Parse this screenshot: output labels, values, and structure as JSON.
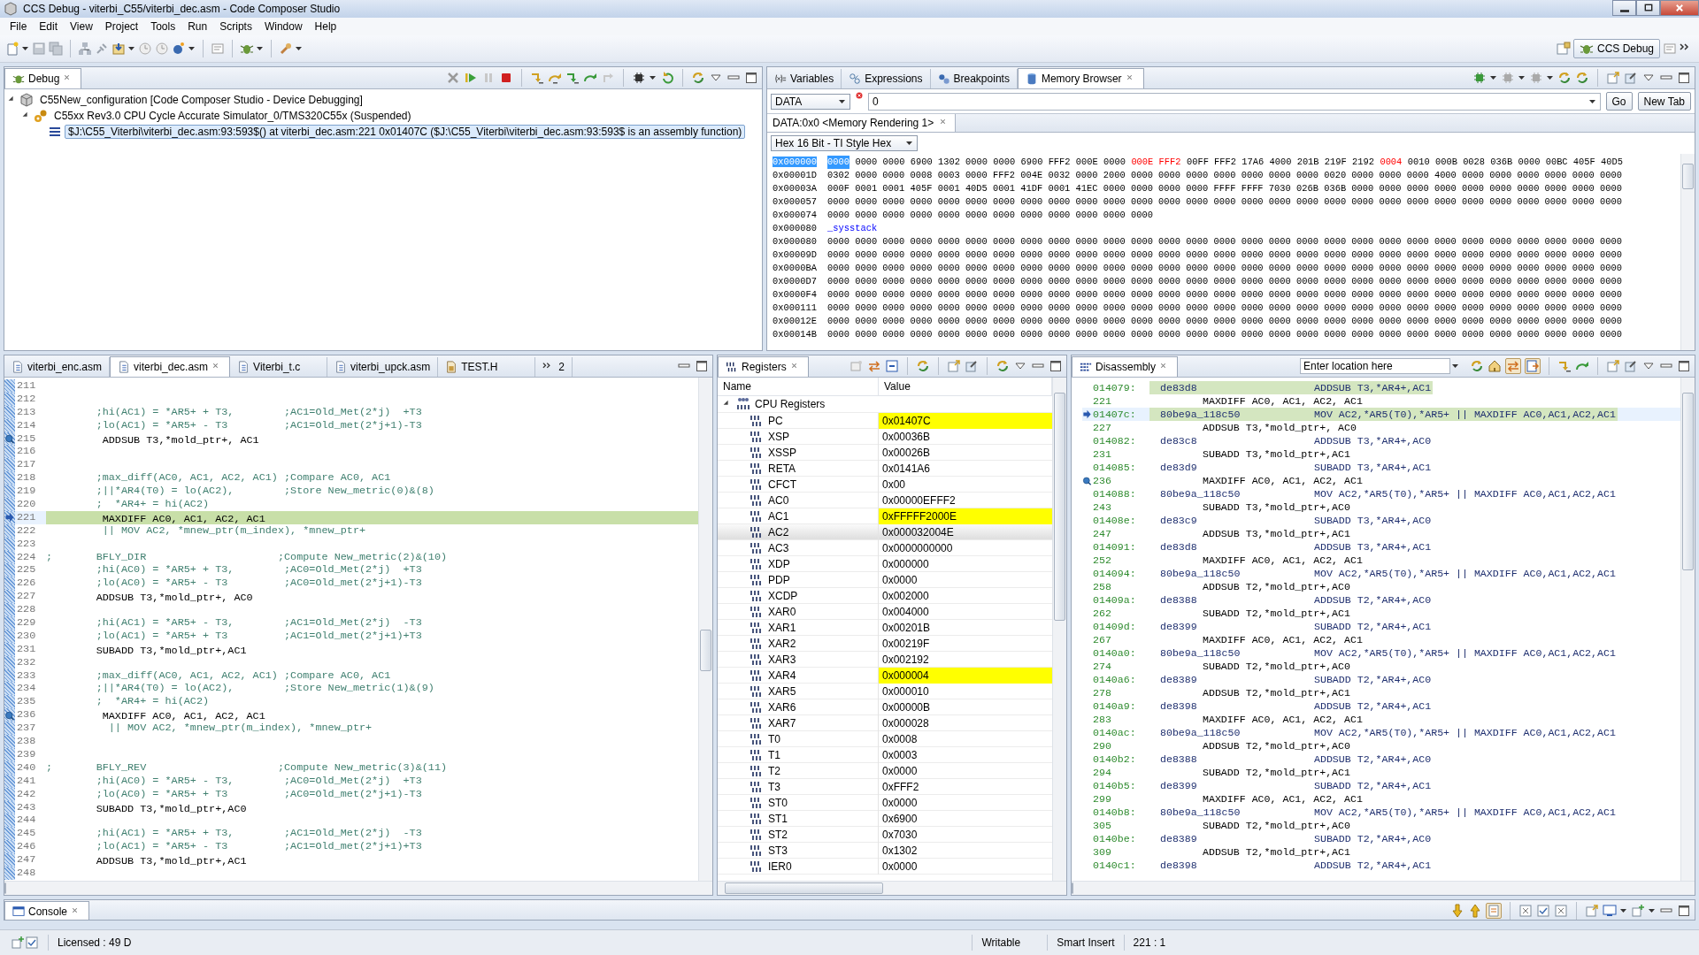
{
  "window": {
    "title": "CCS Debug - viterbi_C55/viterbi_dec.asm - Code Composer Studio"
  },
  "menu": [
    "File",
    "Edit",
    "View",
    "Project",
    "Tools",
    "Run",
    "Scripts",
    "Window",
    "Help"
  ],
  "perspective": {
    "label": "CCS Debug"
  },
  "debug": {
    "tab": "Debug",
    "tree": [
      {
        "label": "C55New_configuration [Code Composer Studio - Device Debugging]",
        "expanded": true,
        "children": [
          {
            "label": "C55xx Rev3.0 CPU Cycle Accurate Simulator_0/TMS320C55x (Suspended)",
            "expanded": true,
            "children": [
              {
                "label": "$J:\\C55_Viterbi\\viterbi_dec.asm:93:593$() at viterbi_dec.asm:221 0x01407C  ($J:\\C55_Viterbi\\viterbi_dec.asm:93:593$ is an assembly function)",
                "selected": true
              }
            ]
          }
        ]
      }
    ]
  },
  "memory_view": {
    "tabs": [
      {
        "label": "Variables",
        "selected": false
      },
      {
        "label": "Expressions",
        "selected": false
      },
      {
        "label": "Breakpoints",
        "selected": false
      },
      {
        "label": "Memory Browser",
        "selected": true
      }
    ],
    "memory_space": "DATA",
    "address": "0",
    "buttons": [
      "Go",
      "New Tab"
    ],
    "rendering_tab": "DATA:0x0 <Memory Rendering 1>",
    "format": "Hex 16 Bit - TI Style Hex",
    "rows": [
      {
        "kind": "data",
        "address": "0x000000",
        "selected": true,
        "segments": [
          {
            "text": "0000",
            "selected": true,
            "changed": false
          },
          {
            "text": "0000 0000 6900 1302 0000 0000 6900 FFF2 000E 0000",
            "selected": false,
            "changed": false
          },
          {
            "text": "000E FFF2",
            "selected": false,
            "changed": true
          },
          {
            "text": "00FF FFF2 17A6 4000 201B 219F 2192",
            "selected": false,
            "changed": false
          },
          {
            "text": "0004",
            "selected": false,
            "changed": true
          },
          {
            "text": "0010 000B 0028 036B 0000 00BC 405F 40D5",
            "selected": false,
            "changed": false
          }
        ]
      },
      {
        "kind": "data",
        "address": "0x00001D",
        "selected": false,
        "segments": [
          {
            "text": "0302 0000 0000 0008 0003 0000 FFF2 004E 0032 0000 2000 0000 0000 0000 0000 0000 0000 0000 0020 0000 0000 0000 4000 0000 0000 0000 0000 0000 0000",
            "selected": false,
            "changed": false
          }
        ]
      },
      {
        "kind": "data",
        "address": "0x00003A",
        "selected": false,
        "segments": [
          {
            "text": "000F 0001 0001 405F 0001 40D5 0001 41DF 0001 41EC 0000 0000 0000 0000 FFFF FFFF 7030 026B 036B 0000 0000 0000 0000 0000 0000 0000 0000 0000 0000",
            "selected": false,
            "changed": false
          }
        ]
      },
      {
        "kind": "data",
        "address": "0x000057",
        "selected": false,
        "segments": [
          {
            "text": "0000 0000 0000 0000 0000 0000 0000 0000 0000 0000 0000 0000 0000 0000 0000 0000 0000 0000 0000 0000 0000 0000 0000 0000 0000 0000 0000 0000 0000",
            "selected": false,
            "changed": false
          }
        ]
      },
      {
        "kind": "data",
        "address": "0x000074",
        "selected": false,
        "segments": [
          {
            "text": "0000 0000 0000 0000 0000 0000 0000 0000 0000 0000 0000 0000",
            "selected": false,
            "changed": false
          }
        ]
      },
      {
        "kind": "label",
        "address": "0x000080",
        "selected": false,
        "label": "_sysstack"
      },
      {
        "kind": "data",
        "address": "0x000080",
        "selected": false,
        "segments": [
          {
            "text": "0000 0000 0000 0000 0000 0000 0000 0000 0000 0000 0000 0000 0000 0000 0000 0000 0000 0000 0000 0000 0000 0000 0000 0000 0000 0000 0000 0000 0000",
            "selected": false,
            "changed": false
          }
        ]
      },
      {
        "kind": "data",
        "address": "0x00009D",
        "selected": false,
        "segments": [
          {
            "text": "0000 0000 0000 0000 0000 0000 0000 0000 0000 0000 0000 0000 0000 0000 0000 0000 0000 0000 0000 0000 0000 0000 0000 0000 0000 0000 0000 0000 0000",
            "selected": false,
            "changed": false
          }
        ]
      },
      {
        "kind": "data",
        "address": "0x0000BA",
        "selected": false,
        "segments": [
          {
            "text": "0000 0000 0000 0000 0000 0000 0000 0000 0000 0000 0000 0000 0000 0000 0000 0000 0000 0000 0000 0000 0000 0000 0000 0000 0000 0000 0000 0000 0000",
            "selected": false,
            "changed": false
          }
        ]
      },
      {
        "kind": "data",
        "address": "0x0000D7",
        "selected": false,
        "segments": [
          {
            "text": "0000 0000 0000 0000 0000 0000 0000 0000 0000 0000 0000 0000 0000 0000 0000 0000 0000 0000 0000 0000 0000 0000 0000 0000 0000 0000 0000 0000 0000",
            "selected": false,
            "changed": false
          }
        ]
      },
      {
        "kind": "data",
        "address": "0x0000F4",
        "selected": false,
        "segments": [
          {
            "text": "0000 0000 0000 0000 0000 0000 0000 0000 0000 0000 0000 0000 0000 0000 0000 0000 0000 0000 0000 0000 0000 0000 0000 0000 0000 0000 0000 0000 0000",
            "selected": false,
            "changed": false
          }
        ]
      },
      {
        "kind": "data",
        "address": "0x000111",
        "selected": false,
        "segments": [
          {
            "text": "0000 0000 0000 0000 0000 0000 0000 0000 0000 0000 0000 0000 0000 0000 0000 0000 0000 0000 0000 0000 0000 0000 0000 0000 0000 0000 0000 0000 0000",
            "selected": false,
            "changed": false
          }
        ]
      },
      {
        "kind": "data",
        "address": "0x00012E",
        "selected": false,
        "segments": [
          {
            "text": "0000 0000 0000 0000 0000 0000 0000 0000 0000 0000 0000 0000 0000 0000 0000 0000 0000 0000 0000 0000 0000 0000 0000 0000 0000 0000 0000 0000 0000",
            "selected": false,
            "changed": false
          }
        ]
      },
      {
        "kind": "data",
        "address": "0x00014B",
        "selected": false,
        "segments": [
          {
            "text": "0000 0000 0000 0000 0000 0000 0000 0000 0000 0000 0000 0000 0000 0000 0000 0000 0000 0000 0000 0000 0000 0000 0000 0000 0000 0000 0000 0000 0000",
            "selected": false,
            "changed": false
          }
        ]
      }
    ]
  },
  "editor": {
    "tabs": [
      {
        "label": "viterbi_enc.asm",
        "selected": false
      },
      {
        "label": "viterbi_dec.asm",
        "selected": true
      },
      {
        "label": "Viterbi_t.c",
        "selected": false
      },
      {
        "label": "viterbi_upck.asm",
        "selected": false
      },
      {
        "label": "TEST.H",
        "selected": false
      }
    ],
    "overflow": "2",
    "lines": [
      {
        "number": "211",
        "breakpoint": false,
        "current": false
      },
      {
        "number": "212",
        "breakpoint": false,
        "current": false
      },
      {
        "number": "213",
        "kind": "comment",
        "text": "        ;hi(AC1) = *AR5+ + T3,        ;AC1=Old_Met(2*j)  +T3",
        "breakpoint": false,
        "current": false
      },
      {
        "number": "214",
        "kind": "comment",
        "text": "        ;lo(AC1) = *AR5+ - T3         ;AC1=Old_met(2*j+1)-T3",
        "breakpoint": false,
        "current": false
      },
      {
        "number": "215",
        "kind": "code",
        "text": "         ADDSUB T3,*mold_ptr+, AC1",
        "breakpoint": true,
        "current": false
      },
      {
        "number": "216",
        "breakpoint": false,
        "current": false
      },
      {
        "number": "217",
        "breakpoint": false,
        "current": false
      },
      {
        "number": "218",
        "kind": "comment",
        "text": "        ;max_diff(AC0, AC1, AC2, AC1) ;Compare AC0, AC1",
        "breakpoint": false,
        "current": false
      },
      {
        "number": "219",
        "kind": "comment",
        "text": "        ;||*AR4(T0) = lo(AC2),        ;Store New_metric(0)&(8)",
        "breakpoint": false,
        "current": false
      },
      {
        "number": "220",
        "kind": "comment",
        "text": "        ;  *AR4+ = hi(AC2)",
        "breakpoint": false,
        "current": false
      },
      {
        "number": "221",
        "kind": "code",
        "text": "         MAXDIFF AC0, AC1, AC2, AC1",
        "breakpoint": false,
        "current": true
      },
      {
        "number": "222",
        "kind": "comment",
        "text": "         || MOV AC2, *mnew_ptr(m_index), *mnew_ptr+",
        "breakpoint": false,
        "current": false
      },
      {
        "number": "223",
        "breakpoint": false,
        "current": false
      },
      {
        "number": "224",
        "kind": "comment",
        "text": ";       BFLY_DIR                     ;Compute New_metric(2)&(10)",
        "breakpoint": false,
        "current": false
      },
      {
        "number": "225",
        "kind": "comment",
        "text": "        ;hi(AC0) = *AR5+ + T3,        ;AC0=Old_Met(2*j)  +T3",
        "breakpoint": false,
        "current": false
      },
      {
        "number": "226",
        "kind": "comment",
        "text": "        ;lo(AC0) = *AR5+ - T3         ;AC0=Old_met(2*j+1)-T3",
        "breakpoint": false,
        "current": false
      },
      {
        "number": "227",
        "kind": "code",
        "text": "        ADDSUB T3,*mold_ptr+, AC0",
        "breakpoint": false,
        "current": false
      },
      {
        "number": "228",
        "breakpoint": false,
        "current": false
      },
      {
        "number": "229",
        "kind": "comment",
        "text": "        ;hi(AC1) = *AR5+ - T3,        ;AC1=Old_Met(2*j)  -T3",
        "breakpoint": false,
        "current": false
      },
      {
        "number": "230",
        "kind": "comment",
        "text": "        ;lo(AC1) = *AR5+ + T3         ;AC1=Old_met(2*j+1)+T3",
        "breakpoint": false,
        "current": false
      },
      {
        "number": "231",
        "kind": "code",
        "text": "        SUBADD T3,*mold_ptr+,AC1",
        "breakpoint": false,
        "current": false
      },
      {
        "number": "232",
        "breakpoint": false,
        "current": false
      },
      {
        "number": "233",
        "kind": "comment",
        "text": "        ;max_diff(AC0, AC1, AC2, AC1) ;Compare AC0, AC1",
        "breakpoint": false,
        "current": false
      },
      {
        "number": "234",
        "kind": "comment",
        "text": "        ;||*AR4(T0) = lo(AC2),        ;Store New_metric(1)&(9)",
        "breakpoint": false,
        "current": false
      },
      {
        "number": "235",
        "kind": "comment",
        "text": "        ;  *AR4+ = hi(AC2)",
        "breakpoint": false,
        "current": false
      },
      {
        "number": "236",
        "kind": "code",
        "text": "         MAXDIFF AC0, AC1, AC2, AC1",
        "breakpoint": true,
        "current": false
      },
      {
        "number": "237",
        "kind": "comment",
        "text": "          || MOV AC2, *mnew_ptr(m_index), *mnew_ptr+",
        "breakpoint": false,
        "current": false
      },
      {
        "number": "238",
        "breakpoint": false,
        "current": false
      },
      {
        "number": "239",
        "breakpoint": false,
        "current": false
      },
      {
        "number": "240",
        "kind": "comment",
        "text": ";       BFLY_REV                     ;Compute New_metric(3)&(11)",
        "breakpoint": false,
        "current": false
      },
      {
        "number": "241",
        "kind": "comment",
        "text": "        ;hi(AC0) = *AR5+ - T3,        ;AC0=Old_Met(2*j)  +T3",
        "breakpoint": false,
        "current": false
      },
      {
        "number": "242",
        "kind": "comment",
        "text": "        ;lo(AC0) = *AR5+ + T3         ;AC0=Old_met(2*j+1)-T3",
        "breakpoint": false,
        "current": false
      },
      {
        "number": "243",
        "kind": "code",
        "text": "        SUBADD T3,*mold_ptr+,AC0",
        "breakpoint": false,
        "current": false
      },
      {
        "number": "244",
        "breakpoint": false,
        "current": false
      },
      {
        "number": "245",
        "kind": "comment",
        "text": "        ;hi(AC1) = *AR5+ + T3,        ;AC1=Old_Met(2*j)  -T3",
        "breakpoint": false,
        "current": false
      },
      {
        "number": "246",
        "kind": "comment",
        "text": "        ;lo(AC1) = *AR5+ - T3         ;AC1=Old_met(2*j+1)+T3",
        "breakpoint": false,
        "current": false
      },
      {
        "number": "247",
        "kind": "code",
        "text": "        ADDSUB T3,*mold_ptr+,AC1",
        "breakpoint": false,
        "current": false
      },
      {
        "number": "248",
        "breakpoint": false,
        "current": false
      }
    ]
  },
  "registers": {
    "tab": "Registers",
    "columns": [
      "Name",
      "Value"
    ],
    "groups": [
      {
        "label": "CPU Registers",
        "expanded": true,
        "children": [
          {
            "name": "PC",
            "value": "0x01407C",
            "changed": true,
            "selected": false
          },
          {
            "name": "XSP",
            "value": "0x00036B",
            "changed": false,
            "selected": false
          },
          {
            "name": "XSSP",
            "value": "0x00026B",
            "changed": false,
            "selected": false
          },
          {
            "name": "RETA",
            "value": "0x0141A6",
            "changed": false,
            "selected": false
          },
          {
            "name": "CFCT",
            "value": "0x00",
            "changed": false,
            "selected": false
          },
          {
            "name": "AC0",
            "value": "0x00000EFFF2",
            "changed": false,
            "selected": false
          },
          {
            "name": "AC1",
            "value": "0xFFFFF2000E",
            "changed": true,
            "selected": false
          },
          {
            "name": "AC2",
            "value": "0x000032004E",
            "changed": false,
            "selected": true
          },
          {
            "name": "AC3",
            "value": "0x0000000000",
            "changed": false,
            "selected": false
          },
          {
            "name": "XDP",
            "value": "0x000000",
            "changed": false,
            "selected": false
          },
          {
            "name": "PDP",
            "value": "0x0000",
            "changed": false,
            "selected": false
          },
          {
            "name": "XCDP",
            "value": "0x002000",
            "changed": false,
            "selected": false
          },
          {
            "name": "XAR0",
            "value": "0x004000",
            "changed": false,
            "selected": false
          },
          {
            "name": "XAR1",
            "value": "0x00201B",
            "changed": false,
            "selected": false
          },
          {
            "name": "XAR2",
            "value": "0x00219F",
            "changed": false,
            "selected": false
          },
          {
            "name": "XAR3",
            "value": "0x002192",
            "changed": false,
            "selected": false
          },
          {
            "name": "XAR4",
            "value": "0x000004",
            "changed": true,
            "selected": false
          },
          {
            "name": "XAR5",
            "value": "0x000010",
            "changed": false,
            "selected": false
          },
          {
            "name": "XAR6",
            "value": "0x00000B",
            "changed": false,
            "selected": false
          },
          {
            "name": "XAR7",
            "value": "0x000028",
            "changed": false,
            "selected": false
          },
          {
            "name": "T0",
            "value": "0x0008",
            "changed": false,
            "selected": false
          },
          {
            "name": "T1",
            "value": "0x0003",
            "changed": false,
            "selected": false
          },
          {
            "name": "T2",
            "value": "0x0000",
            "changed": false,
            "selected": false
          },
          {
            "name": "T3",
            "value": "0xFFF2",
            "changed": false,
            "selected": false
          },
          {
            "name": "ST0",
            "value": "0x0000",
            "changed": false,
            "selected": false
          },
          {
            "name": "ST1",
            "value": "0x6900",
            "changed": false,
            "selected": false
          },
          {
            "name": "ST2",
            "value": "0x7030",
            "changed": false,
            "selected": false
          },
          {
            "name": "ST3",
            "value": "0x1302",
            "changed": false,
            "selected": false
          },
          {
            "name": "IER0",
            "value": "0x0000",
            "changed": false,
            "selected": false
          }
        ]
      }
    ]
  },
  "disassembly": {
    "tab": "Disassembly",
    "location": {
      "placeholder": "Enter location here"
    },
    "rows": [
      {
        "kind": "instruction",
        "address": "014079:",
        "opcode": "de83d8",
        "mnemonic": "ADDSUB T3,*AR4+,AC1",
        "highlighted": true,
        "current": false,
        "breakpoint": false
      },
      {
        "kind": "source",
        "line": "221",
        "text": "MAXDIFF AC0, AC1, AC2, AC1",
        "highlighted": false,
        "current": false,
        "breakpoint": false
      },
      {
        "kind": "instruction",
        "address": "01407c:",
        "opcode": "80be9a_118c50",
        "mnemonic": "MOV AC2,*AR5(T0),*AR5+ || MAXDIFF AC0,AC1,AC2,AC1",
        "highlighted": true,
        "current": true,
        "breakpoint": false
      },
      {
        "kind": "source",
        "line": "227",
        "text": "ADDSUB T3,*mold_ptr+, AC0",
        "highlighted": false,
        "current": false,
        "breakpoint": false
      },
      {
        "kind": "instruction",
        "address": "014082:",
        "opcode": "de83c8",
        "mnemonic": "ADDSUB T3,*AR4+,AC0",
        "highlighted": false,
        "current": false,
        "breakpoint": false
      },
      {
        "kind": "source",
        "line": "231",
        "text": "SUBADD T3,*mold_ptr+,AC1",
        "highlighted": false,
        "current": false,
        "breakpoint": false
      },
      {
        "kind": "instruction",
        "address": "014085:",
        "opcode": "de83d9",
        "mnemonic": "SUBADD T3,*AR4+,AC1",
        "highlighted": false,
        "current": false,
        "breakpoint": false
      },
      {
        "kind": "source",
        "line": "236",
        "text": "MAXDIFF AC0, AC1, AC2, AC1",
        "highlighted": false,
        "current": false,
        "breakpoint": true
      },
      {
        "kind": "instruction",
        "address": "014088:",
        "opcode": "80be9a_118c50",
        "mnemonic": "MOV AC2,*AR5(T0),*AR5+ || MAXDIFF AC0,AC1,AC2,AC1",
        "highlighted": false,
        "current": false,
        "breakpoint": false
      },
      {
        "kind": "source",
        "line": "243",
        "text": "SUBADD T3,*mold_ptr+,AC0",
        "highlighted": false,
        "current": false,
        "breakpoint": false
      },
      {
        "kind": "instruction",
        "address": "01408e:",
        "opcode": "de83c9",
        "mnemonic": "SUBADD T3,*AR4+,AC0",
        "highlighted": false,
        "current": false,
        "breakpoint": false
      },
      {
        "kind": "source",
        "line": "247",
        "text": "ADDSUB T3,*mold_ptr+,AC1",
        "highlighted": false,
        "current": false,
        "breakpoint": false
      },
      {
        "kind": "instruction",
        "address": "014091:",
        "opcode": "de83d8",
        "mnemonic": "ADDSUB T3,*AR4+,AC1",
        "highlighted": false,
        "current": false,
        "breakpoint": false
      },
      {
        "kind": "source",
        "line": "252",
        "text": "MAXDIFF AC0, AC1, AC2, AC1",
        "highlighted": false,
        "current": false,
        "breakpoint": false
      },
      {
        "kind": "instruction",
        "address": "014094:",
        "opcode": "80be9a_118c50",
        "mnemonic": "MOV AC2,*AR5(T0),*AR5+ || MAXDIFF AC0,AC1,AC2,AC1",
        "highlighted": false,
        "current": false,
        "breakpoint": false
      },
      {
        "kind": "source",
        "line": "258",
        "text": "ADDSUB T2,*mold_ptr+,AC0",
        "highlighted": false,
        "current": false,
        "breakpoint": false
      },
      {
        "kind": "instruction",
        "address": "01409a:",
        "opcode": "de8388",
        "mnemonic": "ADDSUB T2,*AR4+,AC0",
        "highlighted": false,
        "current": false,
        "breakpoint": false
      },
      {
        "kind": "source",
        "line": "262",
        "text": "SUBADD T2,*mold_ptr+,AC1",
        "highlighted": false,
        "current": false,
        "breakpoint": false
      },
      {
        "kind": "instruction",
        "address": "01409d:",
        "opcode": "de8399",
        "mnemonic": "SUBADD T2,*AR4+,AC1",
        "highlighted": false,
        "current": false,
        "breakpoint": false
      },
      {
        "kind": "source",
        "line": "267",
        "text": "MAXDIFF AC0, AC1, AC2, AC1",
        "highlighted": false,
        "current": false,
        "breakpoint": false
      },
      {
        "kind": "instruction",
        "address": "0140a0:",
        "opcode": "80be9a_118c50",
        "mnemonic": "MOV AC2,*AR5(T0),*AR5+ || MAXDIFF AC0,AC1,AC2,AC1",
        "highlighted": false,
        "current": false,
        "breakpoint": false
      },
      {
        "kind": "source",
        "line": "274",
        "text": "SUBADD T2,*mold_ptr+,AC0",
        "highlighted": false,
        "current": false,
        "breakpoint": false
      },
      {
        "kind": "instruction",
        "address": "0140a6:",
        "opcode": "de8389",
        "mnemonic": "SUBADD T2,*AR4+,AC0",
        "highlighted": false,
        "current": false,
        "breakpoint": false
      },
      {
        "kind": "source",
        "line": "278",
        "text": "ADDSUB T2,*mold_ptr+,AC1",
        "highlighted": false,
        "current": false,
        "breakpoint": false
      },
      {
        "kind": "instruction",
        "address": "0140a9:",
        "opcode": "de8398",
        "mnemonic": "ADDSUB T2,*AR4+,AC1",
        "highlighted": false,
        "current": false,
        "breakpoint": false
      },
      {
        "kind": "source",
        "line": "283",
        "text": "MAXDIFF AC0, AC1, AC2, AC1",
        "highlighted": false,
        "current": false,
        "breakpoint": false
      },
      {
        "kind": "instruction",
        "address": "0140ac:",
        "opcode": "80be9a_118c50",
        "mnemonic": "MOV AC2,*AR5(T0),*AR5+ || MAXDIFF AC0,AC1,AC2,AC1",
        "highlighted": false,
        "current": false,
        "breakpoint": false
      },
      {
        "kind": "source",
        "line": "290",
        "text": "ADDSUB T2,*mold_ptr+,AC0",
        "highlighted": false,
        "current": false,
        "breakpoint": false
      },
      {
        "kind": "instruction",
        "address": "0140b2:",
        "opcode": "de8388",
        "mnemonic": "ADDSUB T2,*AR4+,AC0",
        "highlighted": false,
        "current": false,
        "breakpoint": false
      },
      {
        "kind": "source",
        "line": "294",
        "text": "SUBADD T2,*mold_ptr+,AC1",
        "highlighted": false,
        "current": false,
        "breakpoint": false
      },
      {
        "kind": "instruction",
        "address": "0140b5:",
        "opcode": "de8399",
        "mnemonic": "SUBADD T2,*AR4+,AC1",
        "highlighted": false,
        "current": false,
        "breakpoint": false
      },
      {
        "kind": "source",
        "line": "299",
        "text": "MAXDIFF AC0, AC1, AC2, AC1",
        "highlighted": false,
        "current": false,
        "breakpoint": false
      },
      {
        "kind": "instruction",
        "address": "0140b8:",
        "opcode": "80be9a_118c50",
        "mnemonic": "MOV AC2,*AR5(T0),*AR5+ || MAXDIFF AC0,AC1,AC2,AC1",
        "highlighted": false,
        "current": false,
        "breakpoint": false
      },
      {
        "kind": "source",
        "line": "305",
        "text": "SUBADD T2,*mold_ptr+,AC0",
        "highlighted": false,
        "current": false,
        "breakpoint": false
      },
      {
        "kind": "instruction",
        "address": "0140be:",
        "opcode": "de8389",
        "mnemonic": "SUBADD T2,*AR4+,AC0",
        "highlighted": false,
        "current": false,
        "breakpoint": false
      },
      {
        "kind": "source",
        "line": "309",
        "text": "ADDSUB T2,*mold_ptr+,AC1",
        "highlighted": false,
        "current": false,
        "breakpoint": false
      },
      {
        "kind": "instruction",
        "address": "0140c1:",
        "opcode": "de8398",
        "mnemonic": "ADDSUB T2,*AR4+,AC1",
        "highlighted": false,
        "current": false,
        "breakpoint": false
      }
    ]
  },
  "console": {
    "tab": "Console"
  },
  "status_bar": [
    "Licensed : 49 D",
    "Writable",
    "Smart Insert",
    "221 : 1"
  ]
}
